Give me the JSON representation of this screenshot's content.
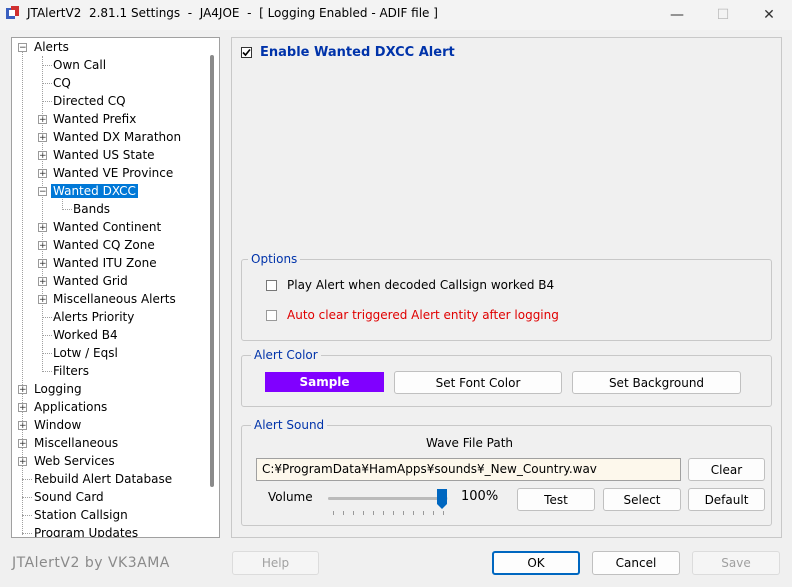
{
  "window": {
    "title": "JTAlertV2  2.81.1 Settings  -  JA4JOE  -  [ Logging Enabled - ADIF file ]",
    "minimize_glyph": "—",
    "maximize_glyph": "☐",
    "close_glyph": "✕"
  },
  "tree": {
    "alerts": "Alerts",
    "own_call": "Own Call",
    "cq": "CQ",
    "directed_cq": "Directed CQ",
    "wanted_prefix": "Wanted Prefix",
    "wanted_dx_marathon": "Wanted DX Marathon",
    "wanted_us_state": "Wanted US State",
    "wanted_ve_province": "Wanted VE Province",
    "wanted_dxcc": "Wanted DXCC",
    "bands": "Bands",
    "wanted_continent": "Wanted Continent",
    "wanted_cq_zone": "Wanted CQ Zone",
    "wanted_itu_zone": "Wanted ITU Zone",
    "wanted_grid": "Wanted Grid",
    "misc_alerts": "Miscellaneous Alerts",
    "alerts_priority": "Alerts Priority",
    "worked_b4": "Worked B4",
    "lotw_eqsl": "Lotw / Eqsl",
    "filters": "Filters",
    "logging": "Logging",
    "applications": "Applications",
    "window": "Window",
    "miscellaneous": "Miscellaneous",
    "web_services": "Web Services",
    "rebuild_alert_db": "Rebuild Alert Database",
    "sound_card": "Sound Card",
    "station_callsign": "Station Callsign",
    "program_updates": "Program Updates"
  },
  "main": {
    "enable_label": "Enable Wanted DXCC Alert",
    "enable_checked": true,
    "options": {
      "title": "Options",
      "play_alert": "Play Alert when decoded Callsign worked B4",
      "auto_clear": "Auto clear triggered Alert entity after logging"
    },
    "alert_color": {
      "title": "Alert Color",
      "sample": "Sample",
      "sample_bg": "#8000ff",
      "set_font_color": "Set Font Color",
      "set_background": "Set Background"
    },
    "alert_sound": {
      "title": "Alert Sound",
      "wave_file_label": "Wave File Path",
      "path": "C:¥ProgramData¥HamApps¥sounds¥_New_Country.wav",
      "clear": "Clear",
      "volume_label": "Volume",
      "volume_value": "100%",
      "volume_level": 1.0,
      "test": "Test",
      "select": "Select",
      "default": "Default"
    }
  },
  "footer": {
    "brand": "JTAlertV2 by VK3AMA",
    "help": "Help",
    "ok": "OK",
    "cancel": "Cancel",
    "save": "Save"
  },
  "colors": {
    "accent_blue": "#0033aa",
    "selection": "#0078d7",
    "warning_red": "#e00000"
  }
}
